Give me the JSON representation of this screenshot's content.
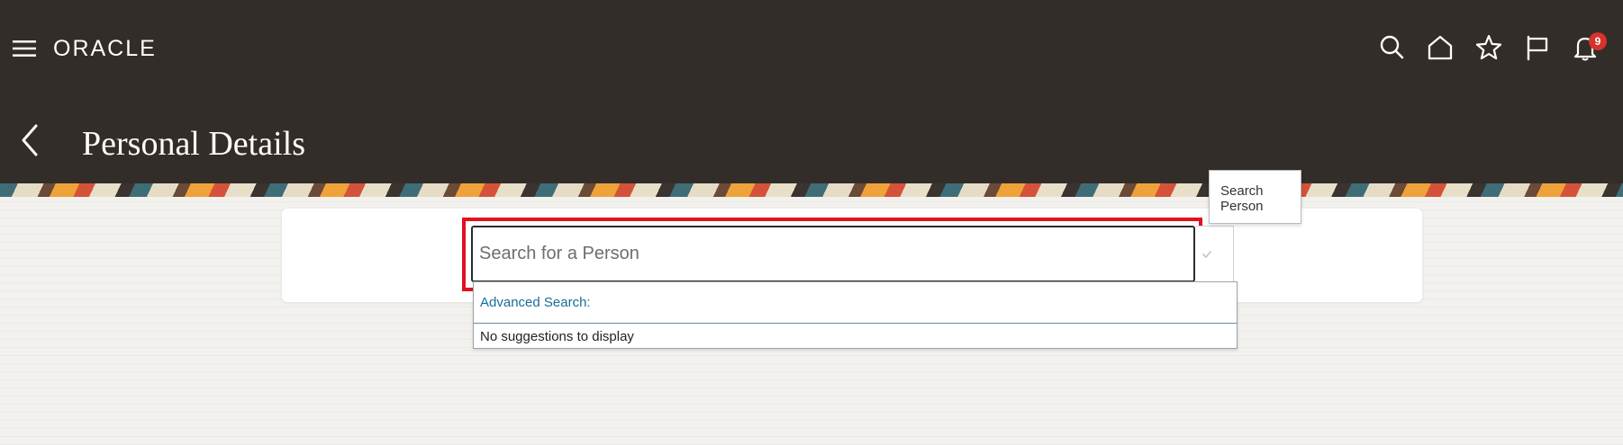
{
  "header": {
    "logo_text": "ORACLE",
    "notification_count": "9",
    "icons": [
      "menu-icon",
      "search-icon",
      "home-icon",
      "star-icon",
      "flag-icon",
      "bell-icon"
    ],
    "colors": {
      "header_bg": "#332d29",
      "badge": "#d8322b",
      "highlight": "#e3101f",
      "link": "#1a6b9b"
    }
  },
  "page": {
    "title": "Personal Details"
  },
  "search": {
    "placeholder": "Search for a Person",
    "value": "",
    "dropdown": {
      "advanced_label": "Advanced Search:",
      "empty_message": "No suggestions to display"
    },
    "tooltip": "Search Person"
  }
}
